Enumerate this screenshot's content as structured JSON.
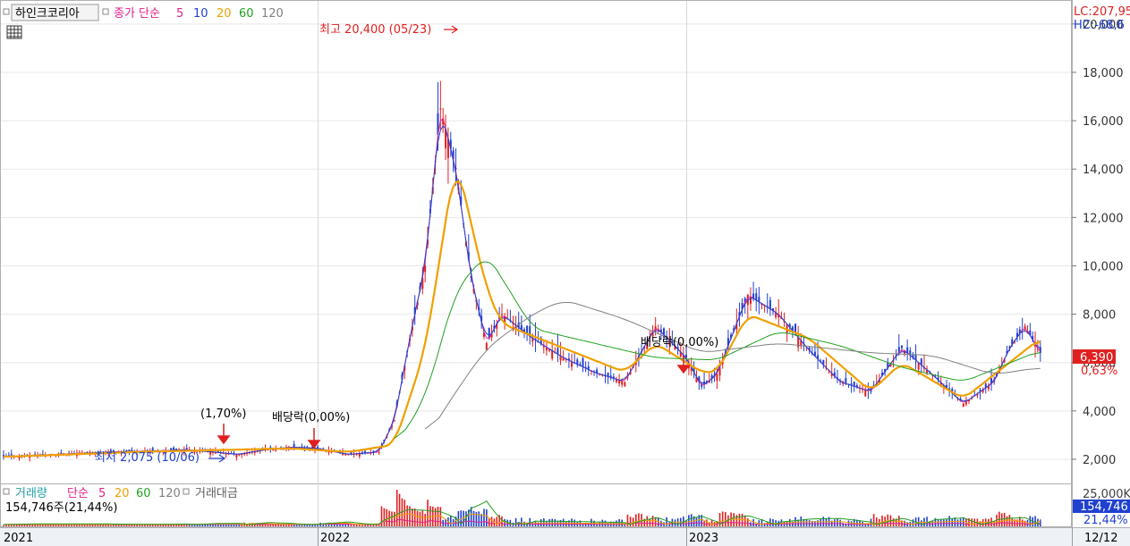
{
  "legend": {
    "stock_name": "하인크코리아",
    "price_series": "종가 단순",
    "ma_periods": [
      "5",
      "10",
      "20",
      "60",
      "120"
    ],
    "ma_colors": [
      "#e0208a",
      "#2040d0",
      "#f0a000",
      "#20a020",
      "#808080"
    ]
  },
  "volume_legend": {
    "title": "거래량",
    "series": "단순",
    "ma_periods": [
      "5",
      "20",
      "60",
      "120"
    ],
    "extra": "거래대금",
    "current_volume": "154,746주(21,44%)"
  },
  "right_axis": {
    "lc": "LC:207,95",
    "hc": "HC:-68,6",
    "ticks": [
      "20,000",
      "18,000",
      "16,000",
      "14,000",
      "12,000",
      "10,000",
      "8,000",
      "6,000",
      "4,000",
      "2,000"
    ],
    "current_price": "6,390",
    "current_change": "0,63%",
    "volume_tick": "25,000K",
    "current_volume_box": "154,746",
    "current_volume_pct": "21,44%"
  },
  "annotations": {
    "high": "최고 20,400 (05/23)",
    "low": "최저 2,075 (10/06)",
    "rights_1": "(1,70%)",
    "dividend_1": "배당락(0,00%)",
    "dividend_2": "배당락(0,00%)"
  },
  "x_axis": {
    "labels": [
      "2021",
      "2022",
      "2023"
    ],
    "last_date": "12/12"
  },
  "chart_data": {
    "type": "candlestick",
    "title": "하인크코리아",
    "ylim": [
      1000,
      20400
    ],
    "y_ticks": [
      2000,
      4000,
      6000,
      8000,
      10000,
      12000,
      14000,
      16000,
      18000,
      20000
    ],
    "x_ticks": [
      "2021",
      "2022",
      "2023"
    ],
    "grid": true,
    "close_trend": [
      {
        "t": "2021-01",
        "close": 2100
      },
      {
        "t": "2021-03",
        "close": 2200
      },
      {
        "t": "2021-05",
        "close": 2300
      },
      {
        "t": "2021-07",
        "close": 2350
      },
      {
        "t": "2021-08",
        "close": 2400
      },
      {
        "t": "2021-10",
        "close": 2200
      },
      {
        "t": "2021-11",
        "close": 2400
      },
      {
        "t": "2021-12",
        "close": 2500
      },
      {
        "t": "2022-01",
        "close": 2450
      },
      {
        "t": "2022-02",
        "close": 2200
      },
      {
        "t": "2022-03",
        "close": 2300
      },
      {
        "t": "2022-03b",
        "close": 3600
      },
      {
        "t": "2022-04",
        "close": 7000
      },
      {
        "t": "2022-04b",
        "close": 10000
      },
      {
        "t": "2022-05",
        "close": 16500
      },
      {
        "t": "2022-05b",
        "close": 14000
      },
      {
        "t": "2022-06",
        "close": 9500
      },
      {
        "t": "2022-06b",
        "close": 6800
      },
      {
        "t": "2022-07",
        "close": 8000
      },
      {
        "t": "2022-08",
        "close": 7000
      },
      {
        "t": "2022-09",
        "close": 6200
      },
      {
        "t": "2022-10",
        "close": 5600
      },
      {
        "t": "2022-11",
        "close": 5200
      },
      {
        "t": "2022-12",
        "close": 7500
      },
      {
        "t": "2023-01",
        "close": 6200
      },
      {
        "t": "2023-01b",
        "close": 5000
      },
      {
        "t": "2023-02",
        "close": 5500
      },
      {
        "t": "2023-03",
        "close": 8800
      },
      {
        "t": "2023-04",
        "close": 8000
      },
      {
        "t": "2023-05",
        "close": 6500
      },
      {
        "t": "2023-06",
        "close": 5200
      },
      {
        "t": "2023-07",
        "close": 4800
      },
      {
        "t": "2023-08",
        "close": 6600
      },
      {
        "t": "2023-09",
        "close": 5500
      },
      {
        "t": "2023-10",
        "close": 4300
      },
      {
        "t": "2023-11",
        "close": 5200
      },
      {
        "t": "2023-11b",
        "close": 6600
      },
      {
        "t": "2023-12",
        "close": 7500
      },
      {
        "t": "2023-12b",
        "close": 6390
      }
    ],
    "ma20_trend": [
      {
        "t": "2021-01",
        "v": 2100
      },
      {
        "t": "2021-06",
        "v": 2300
      },
      {
        "t": "2021-12",
        "v": 2450
      },
      {
        "t": "2022-02",
        "v": 2300
      },
      {
        "t": "2022-03b",
        "v": 2600
      },
      {
        "t": "2022-04b",
        "v": 6500
      },
      {
        "t": "2022-05b",
        "v": 14500
      },
      {
        "t": "2022-06b",
        "v": 9000
      },
      {
        "t": "2022-07",
        "v": 7600
      },
      {
        "t": "2022-09",
        "v": 6600
      },
      {
        "t": "2022-11",
        "v": 5600
      },
      {
        "t": "2022-12",
        "v": 6800
      },
      {
        "t": "2023-01b",
        "v": 5600
      },
      {
        "t": "2023-02",
        "v": 5600
      },
      {
        "t": "2023-03",
        "v": 8000
      },
      {
        "t": "2023-05",
        "v": 7000
      },
      {
        "t": "2023-07",
        "v": 4800
      },
      {
        "t": "2023-08",
        "v": 6000
      },
      {
        "t": "2023-10",
        "v": 4500
      },
      {
        "t": "2023-11b",
        "v": 6000
      },
      {
        "t": "2023-12b",
        "v": 7000
      }
    ],
    "ma60_trend": [
      {
        "t": "2022-03b",
        "v": 2500
      },
      {
        "t": "2022-04b",
        "v": 4500
      },
      {
        "t": "2022-05b",
        "v": 9000
      },
      {
        "t": "2022-06b",
        "v": 10500
      },
      {
        "t": "2022-07",
        "v": 9500
      },
      {
        "t": "2022-08",
        "v": 7400
      },
      {
        "t": "2022-10",
        "v": 6800
      },
      {
        "t": "2022-12",
        "v": 6200
      },
      {
        "t": "2023-02",
        "v": 6100
      },
      {
        "t": "2023-04",
        "v": 7300
      },
      {
        "t": "2023-06",
        "v": 6700
      },
      {
        "t": "2023-08",
        "v": 5800
      },
      {
        "t": "2023-10",
        "v": 5200
      },
      {
        "t": "2023-12b",
        "v": 6500
      }
    ],
    "ma120_trend": [
      {
        "t": "2022-04b",
        "v": 2800
      },
      {
        "t": "2022-05b",
        "v": 4800
      },
      {
        "t": "2022-06b",
        "v": 6600
      },
      {
        "t": "2022-08",
        "v": 8000
      },
      {
        "t": "2022-09",
        "v": 8600
      },
      {
        "t": "2022-11",
        "v": 7800
      },
      {
        "t": "2023-01b",
        "v": 6400
      },
      {
        "t": "2023-04",
        "v": 6800
      },
      {
        "t": "2023-07",
        "v": 6400
      },
      {
        "t": "2023-09",
        "v": 6300
      },
      {
        "t": "2023-11",
        "v": 5500
      },
      {
        "t": "2023-12b",
        "v": 5800
      }
    ]
  }
}
